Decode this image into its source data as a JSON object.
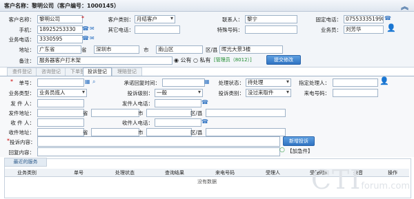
{
  "window": {
    "title": "客户名称：黎明公司（客户编号：1000145）",
    "collapse_icon": "double-chevron-up-icon"
  },
  "customer": {
    "name_label": "客户名称：",
    "name_value": "黎明公司",
    "type_label": "客户类别：",
    "type_value": "月结客户",
    "contact_label": "联系人：",
    "contact_value": "黎宁",
    "phone_label": "固定电话：",
    "phone_value": "075533351998",
    "mobile_label": "手机：",
    "mobile_value": "18925253330",
    "other_phone_label": "其它电话：",
    "other_phone_value": "",
    "special_label": "特殊号码：",
    "special_value": "",
    "salesman_label": "业务员：",
    "salesman_value": "刘芳华",
    "biz_phone_label": "业务电话：",
    "biz_phone_value": "3330595",
    "address_label": "地址：",
    "province_value": "广东省",
    "province_unit": "省",
    "city_value": "深圳市",
    "city_unit": "市",
    "district_value": "南山区",
    "district_unit": "区/县",
    "street_value": "晖光大景3楼",
    "note_label": "备注：",
    "note_value": "服务器客户打木架",
    "vis_public": "公有",
    "vis_private": "私有",
    "admin_tag": "[管理员（8012）]",
    "submit_label": "提交修改"
  },
  "tabs": [
    "查件登记",
    "咨询登记",
    "下单登记",
    "投诉登记",
    "理赔登记"
  ],
  "active_tab": 3,
  "complaint": {
    "waybill_label": "单号：",
    "waybill_value": "",
    "promise_label": "承诺回复时间：",
    "promise_value": "",
    "status_label": "处理状态：",
    "status_value": "待处理",
    "handler_label": "指定处理人：",
    "handler_value": "",
    "biztype_label": "业务类型：",
    "biztype_value": "业务员揽人",
    "level_label": "投诉级别：",
    "level_value": "一般",
    "ctype_label": "投诉类别：",
    "ctype_value": "没过来取件",
    "caller_label": "来电号码：",
    "caller_value": "",
    "sender_label": "发 件 人：",
    "sender_value": "",
    "sender_phone_label": "发件人电话：",
    "sender_phone_value": "",
    "send_addr_label": "发件地址：",
    "province_unit": "省",
    "city_unit": "市",
    "district_unit": "区/县",
    "receiver_label": "收 件 人：",
    "receiver_value": "",
    "receiver_phone_label": "收件人电话：",
    "receiver_phone_value": "",
    "recv_addr_label": "收件地址：",
    "content_label": "投诉内容：",
    "content_value": "",
    "new_btn": "新增投诉",
    "reply_label": "回复内容：",
    "reply_value": "",
    "add_image": "【加急件】"
  },
  "grid": {
    "tab_label": "最近的服务",
    "columns": [
      "业务类别",
      "单号",
      "处理状态",
      "查询结果",
      "来电号码",
      "受理人",
      "受理时间",
      "录音",
      "操作"
    ],
    "empty_text": "没有数据"
  },
  "watermark": {
    "big": "CTI",
    "small": "forum.com"
  }
}
